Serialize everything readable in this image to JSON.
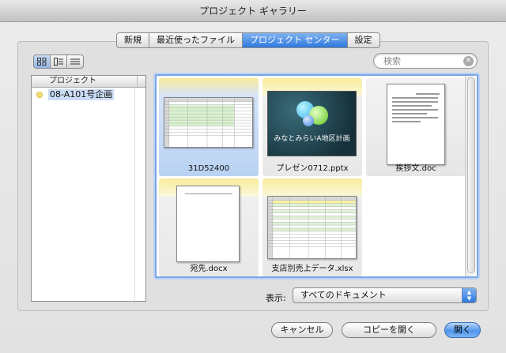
{
  "window": {
    "title": "プロジェクト ギャラリー"
  },
  "tabs": [
    {
      "label": "新規",
      "active": false
    },
    {
      "label": "最近使ったファイル",
      "active": false
    },
    {
      "label": "プロジェクト センター",
      "active": true
    },
    {
      "label": "設定",
      "active": false
    }
  ],
  "view_modes": [
    "grid-view-icon",
    "column-view-icon",
    "list-view-icon"
  ],
  "search": {
    "placeholder": "検索",
    "value": ""
  },
  "sidebar": {
    "header": "プロジェクト",
    "items": [
      {
        "label": "08-A101号企画",
        "color": "#f2df74",
        "selected": true
      }
    ]
  },
  "gallery": {
    "items": [
      {
        "name": "31D52400",
        "kind": "spreadsheet",
        "selected": true
      },
      {
        "name": "プレゼン0712.pptx",
        "kind": "presentation",
        "slide_title": "みなとみらいA地区計画"
      },
      {
        "name": "挨拶文.doc",
        "kind": "document"
      },
      {
        "name": "宛先.docx",
        "kind": "document"
      },
      {
        "name": "支店別売上データ.xlsx",
        "kind": "spreadsheet"
      }
    ]
  },
  "filter": {
    "label": "表示:",
    "value": "すべてのドキュメント"
  },
  "buttons": {
    "cancel": "キャンセル",
    "open_copy": "コピーを開く",
    "open": "開く"
  },
  "colors": {
    "accent": "#2f78de",
    "selection": "#b9d2f3",
    "highlight": "#f7ec9a"
  }
}
